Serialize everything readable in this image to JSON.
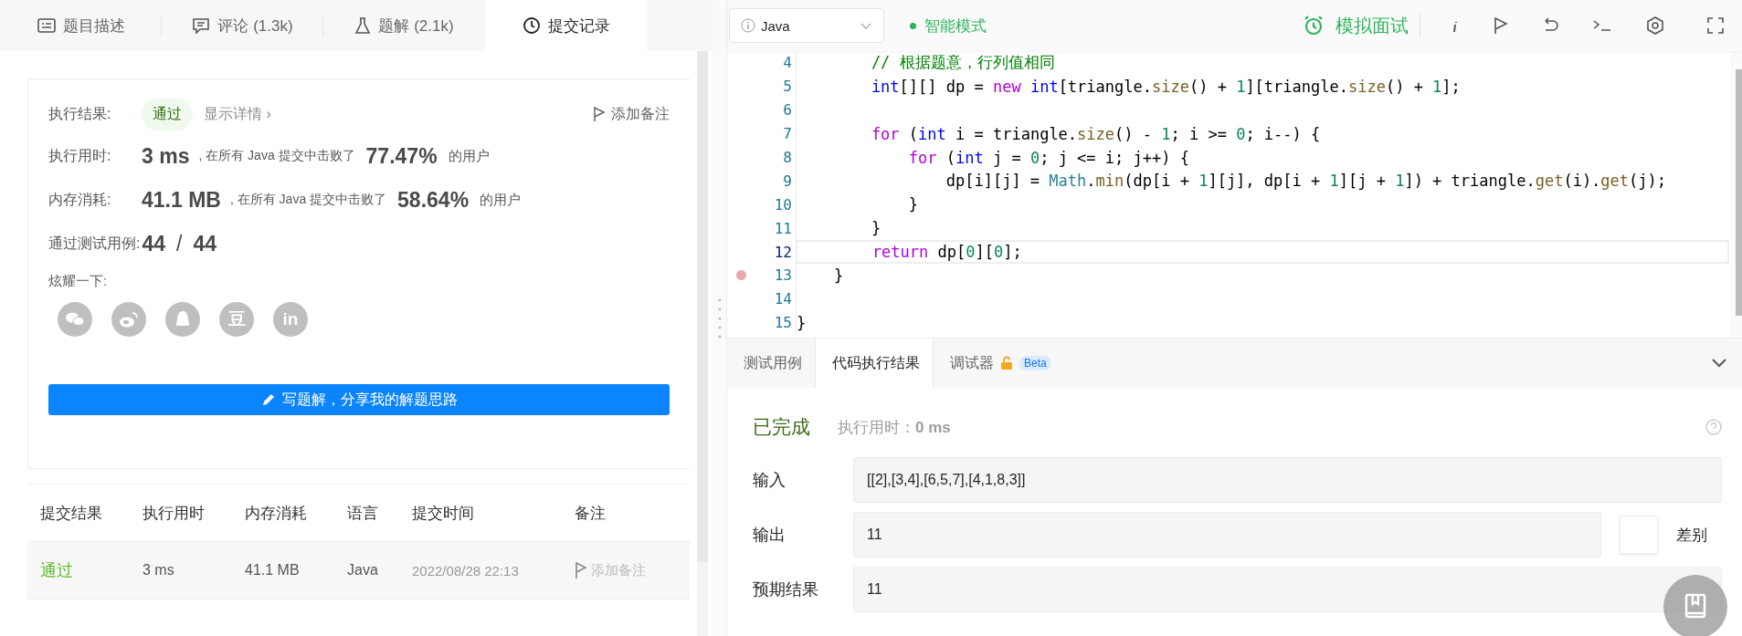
{
  "left_tabs": [
    {
      "label": "题目描述",
      "selected": false
    },
    {
      "label": "评论 (1.3k)",
      "selected": false
    },
    {
      "label": "题解 (2.1k)",
      "selected": false
    },
    {
      "label": "提交记录",
      "selected": true
    }
  ],
  "result": {
    "label": "执行结果:",
    "status": "通过",
    "details_link": "显示详情 ›",
    "note_button": "添加备注"
  },
  "stats": [
    {
      "label": "执行用时:",
      "value": "3 ms",
      "text": ", 在所有 Java 提交中击败了",
      "percent": "77.47%",
      "suffix": "的用户"
    },
    {
      "label": "内存消耗:",
      "value": "41.1 MB",
      "text": ", 在所有 Java 提交中击败了",
      "percent": "58.64%",
      "suffix": "的用户"
    }
  ],
  "tests": {
    "label": "通过测试用例:",
    "passed": "44",
    "separator": "/",
    "total": "44"
  },
  "share": {
    "label": "炫耀一下:",
    "buttons": [
      {
        "kind": "chat"
      },
      {
        "kind": "swirl"
      },
      {
        "kind": "penguin"
      },
      {
        "kind": "glyph",
        "text": "豆"
      },
      {
        "kind": "glyph",
        "text": "in"
      }
    ]
  },
  "write_button": "写题解，分享我的解题思路",
  "table": {
    "columns": [
      "提交结果",
      "执行用时",
      "内存消耗",
      "语言",
      "提交时间",
      "备注"
    ],
    "rows": [
      {
        "result": "通过",
        "runtime": "3 ms",
        "memory": "41.1 MB",
        "language": "Java",
        "time": "2022/08/28 22:13",
        "note": "添加备注"
      }
    ]
  },
  "language_select": "Java",
  "mode": "智能模式",
  "interview_button": "模拟面试",
  "code_lines": [
    {
      "number": "4",
      "current": false,
      "breakpoint": false,
      "tokens": [
        {
          "kind": "comment",
          "text": "        // 根据题意，行列值相同"
        }
      ]
    },
    {
      "number": "5",
      "current": false,
      "breakpoint": false,
      "tokens": [
        {
          "kind": "type",
          "text": "        int"
        },
        {
          "kind": "plain",
          "text": "[][] dp = "
        },
        {
          "kind": "keyword",
          "text": "new "
        },
        {
          "kind": "type",
          "text": "int"
        },
        {
          "kind": "plain",
          "text": "[triangle."
        },
        {
          "kind": "method",
          "text": "size"
        },
        {
          "kind": "plain",
          "text": "() + "
        },
        {
          "kind": "number",
          "text": "1"
        },
        {
          "kind": "plain",
          "text": "][triangle."
        },
        {
          "kind": "method",
          "text": "size"
        },
        {
          "kind": "plain",
          "text": "() + "
        },
        {
          "kind": "number",
          "text": "1"
        },
        {
          "kind": "plain",
          "text": "];"
        }
      ]
    },
    {
      "number": "6",
      "current": false,
      "breakpoint": false
    },
    {
      "number": "7",
      "current": false,
      "breakpoint": false,
      "tokens": [
        {
          "kind": "keyword",
          "text": "        for"
        },
        {
          "kind": "plain",
          "text": " ("
        },
        {
          "kind": "type",
          "text": "int"
        },
        {
          "kind": "plain",
          "text": " i = triangle."
        },
        {
          "kind": "method",
          "text": "size"
        },
        {
          "kind": "plain",
          "text": "() - "
        },
        {
          "kind": "number",
          "text": "1"
        },
        {
          "kind": "plain",
          "text": "; i >= "
        },
        {
          "kind": "number",
          "text": "0"
        },
        {
          "kind": "plain",
          "text": "; i--) {"
        }
      ]
    },
    {
      "number": "8",
      "current": false,
      "breakpoint": false,
      "tokens": [
        {
          "kind": "keyword",
          "text": "            for"
        },
        {
          "kind": "plain",
          "text": " ("
        },
        {
          "kind": "type",
          "text": "int"
        },
        {
          "kind": "plain",
          "text": " j = "
        },
        {
          "kind": "number",
          "text": "0"
        },
        {
          "kind": "plain",
          "text": "; j <= i; j++) {"
        }
      ]
    },
    {
      "number": "9",
      "current": false,
      "breakpoint": false,
      "tokens": [
        {
          "kind": "plain",
          "text": "                dp[i][j] = "
        },
        {
          "kind": "class",
          "text": "Math"
        },
        {
          "kind": "plain",
          "text": "."
        },
        {
          "kind": "method",
          "text": "min"
        },
        {
          "kind": "plain",
          "text": "(dp[i + "
        },
        {
          "kind": "number",
          "text": "1"
        },
        {
          "kind": "plain",
          "text": "][j], dp[i + "
        },
        {
          "kind": "number",
          "text": "1"
        },
        {
          "kind": "plain",
          "text": "][j + "
        },
        {
          "kind": "number",
          "text": "1"
        },
        {
          "kind": "plain",
          "text": "]) + triangle."
        },
        {
          "kind": "method",
          "text": "get"
        },
        {
          "kind": "plain",
          "text": "(i)."
        },
        {
          "kind": "method",
          "text": "get"
        },
        {
          "kind": "plain",
          "text": "(j);"
        }
      ]
    },
    {
      "number": "10",
      "current": false,
      "breakpoint": false,
      "tokens": [
        {
          "kind": "plain",
          "text": "            }"
        }
      ]
    },
    {
      "number": "11",
      "current": false,
      "breakpoint": false,
      "tokens": [
        {
          "kind": "plain",
          "text": "        }"
        }
      ]
    },
    {
      "number": "12",
      "current": true,
      "breakpoint": false,
      "tokens": [
        {
          "kind": "keyword",
          "text": "        return"
        },
        {
          "kind": "plain",
          "text": " dp["
        },
        {
          "kind": "number",
          "text": "0"
        },
        {
          "kind": "plain",
          "text": "]["
        },
        {
          "kind": "number",
          "text": "0"
        },
        {
          "kind": "plain",
          "text": "];"
        }
      ]
    },
    {
      "number": "13",
      "current": false,
      "breakpoint": true,
      "tokens": [
        {
          "kind": "plain",
          "text": "    }"
        }
      ]
    },
    {
      "number": "14",
      "current": false,
      "breakpoint": false
    },
    {
      "number": "15",
      "current": false,
      "breakpoint": false,
      "tokens": [
        {
          "kind": "plain",
          "text": "}"
        }
      ]
    }
  ],
  "bottom_tabs": [
    {
      "label": "测试用例",
      "selected": false
    },
    {
      "label": "代码执行结果",
      "selected": true
    },
    {
      "label": "调试器",
      "selected": false,
      "badge": "Beta"
    }
  ],
  "run_result": {
    "status": "已完成",
    "runtime": "执行用时：**0 ms**"
  },
  "fields": [
    {
      "label": "输入",
      "value": "[[2],[3,4],[6,5,7],[4,1,8,3]]"
    },
    {
      "label": "输出",
      "value": "11",
      "diff": "差别"
    },
    {
      "label": "预期结果",
      "value": "11"
    }
  ]
}
